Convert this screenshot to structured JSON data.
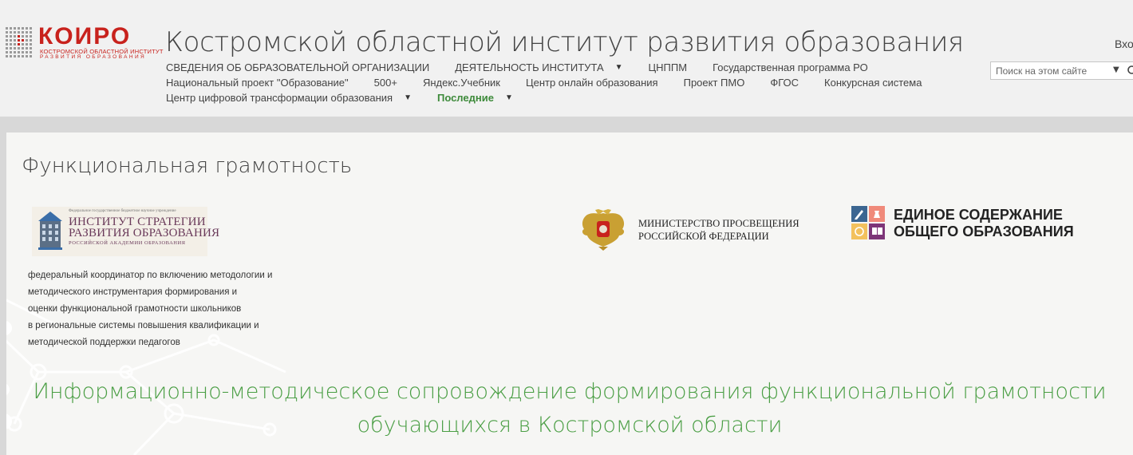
{
  "header": {
    "logo": {
      "name": "КОИРО",
      "sub1": "КОСТРОМСКОЙ ОБЛАСТНОЙ ИНСТИТУТ",
      "sub2": "РАЗВИТИЯ ОБРАЗОВАНИЯ",
      "color": "#c8221d"
    },
    "site_title": "Костромской областной институт развития образования",
    "login_label": "Вход",
    "search": {
      "placeholder": "Поиск на этом сайте"
    },
    "nav": {
      "row1": [
        {
          "label": "СВЕДЕНИЯ ОБ ОБРАЗОВАТЕЛЬНОЙ ОРГАНИЗАЦИИ"
        },
        {
          "label": "ДЕЯТЕЛЬНОСТЬ ИНСТИТУТА"
        },
        {
          "label": "ЦНППМ"
        },
        {
          "label": "Государственная программа РО"
        }
      ],
      "row2": [
        {
          "label": "Национальный проект \"Образование\""
        },
        {
          "label": "500+"
        },
        {
          "label": "Яндекс.Учебник"
        },
        {
          "label": "Центр онлайн образования"
        },
        {
          "label": "Проект ПМО"
        },
        {
          "label": "ФГОС"
        },
        {
          "label": "Конкурсная система"
        }
      ],
      "row3": [
        {
          "label": "Центр цифровой трансформации образования"
        },
        {
          "label": "Последние"
        }
      ],
      "active_color": "#3d8a3a"
    }
  },
  "main": {
    "page_title": "Функциональная грамотность",
    "isro_logo": {
      "line0": "Федеральное государственное бюджетное научное учреждение",
      "line1": "ИНСТИТУТ СТРАТЕГИИ",
      "line2": "РАЗВИТИЯ ОБРАЗОВАНИЯ",
      "line3": "РОССИЙСКОЙ АКАДЕМИИ ОБРАЗОВАНИЯ"
    },
    "description_lines": [
      "федеральный координатор по включению методологии и",
      "методического инструментария формирования и",
      "оценки функциональной грамотности школьников",
      "в региональные системы повышения квалификации и",
      "методической поддержки педагогов"
    ],
    "ministry": {
      "line1": "МИНИСТЕРСТВО ПРОСВЕЩЕНИЯ",
      "line2": "РОССИЙСКОЙ ФЕДЕРАЦИИ"
    },
    "edinoe": {
      "line1": "ЕДИНОЕ СОДЕРЖАНИЕ",
      "line2": "ОБЩЕГО ОБРАЗОВАНИЯ"
    },
    "headline": {
      "line1": "Информационно-методическое сопровождение формирования функциональной грамотности",
      "line2": "обучающихся в Костромской области",
      "color": "#4a9e44"
    }
  }
}
